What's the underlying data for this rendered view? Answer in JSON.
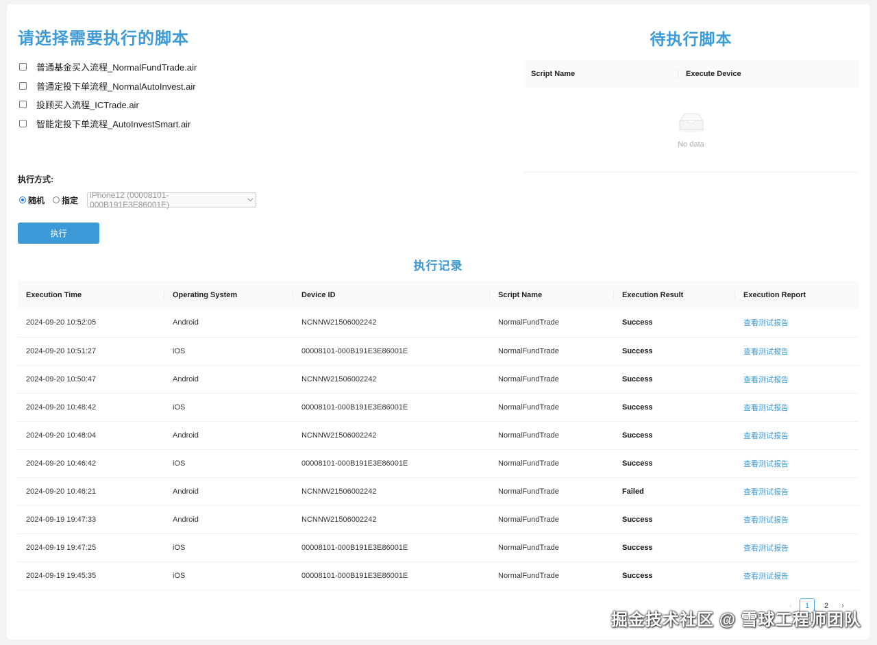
{
  "left_panel": {
    "title": "请选择需要执行的脚本",
    "scripts": [
      "普通基金买入流程_NormalFundTrade.air",
      "普通定投下单流程_NormalAutoInvest.air",
      "投顾买入流程_ICTrade.air",
      "智能定投下单流程_AutoInvestSmart.air"
    ],
    "mode_label": "执行方式:",
    "mode_random": "随机",
    "mode_specified": "指定",
    "selected_mode": "随机",
    "device_select_value": "iPhone12 (00008101-000B191E3E86001E)",
    "execute_button": "执行"
  },
  "right_panel": {
    "title": "待执行脚本",
    "columns": [
      "Script Name",
      "Execute Device"
    ],
    "empty_text": "No data"
  },
  "records": {
    "title": "执行记录",
    "columns": [
      "Execution Time",
      "Operating System",
      "Device ID",
      "Script Name",
      "Execution Result",
      "Execution Report"
    ],
    "rows": [
      [
        "2024-09-20 10:52:05",
        "Android",
        "NCNNW21506002242",
        "NormalFundTrade",
        "Success",
        "查看测试报告"
      ],
      [
        "2024-09-20 10:51:27",
        "iOS",
        "00008101-000B191E3E86001E",
        "NormalFundTrade",
        "Success",
        "查看测试报告"
      ],
      [
        "2024-09-20 10:50:47",
        "Android",
        "NCNNW21506002242",
        "NormalFundTrade",
        "Success",
        "查看测试报告"
      ],
      [
        "2024-09-20 10:48:42",
        "iOS",
        "00008101-000B191E3E86001E",
        "NormalFundTrade",
        "Success",
        "查看测试报告"
      ],
      [
        "2024-09-20 10:48:04",
        "Android",
        "NCNNW21506002242",
        "NormalFundTrade",
        "Success",
        "查看测试报告"
      ],
      [
        "2024-09-20 10:46:42",
        "iOS",
        "00008101-000B191E3E86001E",
        "NormalFundTrade",
        "Success",
        "查看测试报告"
      ],
      [
        "2024-09-20 10:46:21",
        "Android",
        "NCNNW21506002242",
        "NormalFundTrade",
        "Failed",
        "查看测试报告"
      ],
      [
        "2024-09-19 19:47:33",
        "Android",
        "NCNNW21506002242",
        "NormalFundTrade",
        "Success",
        "查看测试报告"
      ],
      [
        "2024-09-19 19:47:25",
        "iOS",
        "00008101-000B191E3E86001E",
        "NormalFundTrade",
        "Success",
        "查看测试报告"
      ],
      [
        "2024-09-19 19:45:35",
        "iOS",
        "00008101-000B191E3E86001E",
        "NormalFundTrade",
        "Success",
        "查看测试报告"
      ]
    ]
  },
  "pagination": {
    "prev": "‹",
    "pages": [
      "1",
      "2"
    ],
    "current": "1",
    "next": "›"
  },
  "watermark": "掘金技术社区 @ 雪球工程师团队",
  "colors": {
    "accent": "#3d9ad8",
    "background": "#f2f3f5",
    "header_bg": "#fafafa"
  },
  "icons": {
    "empty_state": "empty-inbox-icon"
  }
}
